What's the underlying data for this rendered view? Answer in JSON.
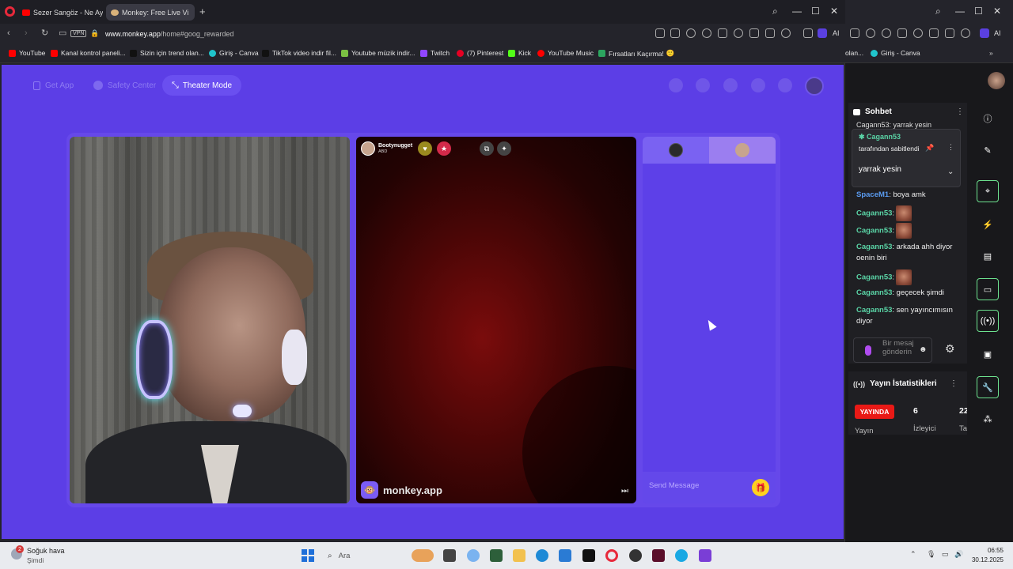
{
  "browser": {
    "tabs": [
      {
        "title": "Sezer Sangöz - Ne Ay Ge",
        "icon": "youtube-icon"
      },
      {
        "title": "Monkey: Free Live Vi",
        "icon": "monkey-icon"
      }
    ],
    "new_tab": "+",
    "vpn_label": "VPN",
    "url_host": "www.monkey.app",
    "url_path": "/home#goog_rewarded",
    "ai_label": "AI",
    "bookmarks": [
      {
        "label": "YouTube",
        "color": "#ff0000"
      },
      {
        "label": "Kanal kontrol paneli...",
        "color": "#ff0000"
      },
      {
        "label": "Sizin için trend olan...",
        "color": "#111111"
      },
      {
        "label": "Giriş - Canva",
        "color": "#20c4cb"
      },
      {
        "label": "TikTok video indir fil...",
        "color": "#111111"
      },
      {
        "label": "Youtube müzik indir...",
        "color": "#7bc043"
      },
      {
        "label": "Twitch",
        "color": "#9146ff"
      },
      {
        "label": "(7) Pinterest",
        "color": "#e60023"
      },
      {
        "label": "Kick",
        "color": "#53fc18"
      },
      {
        "label": "YouTube Music",
        "color": "#ff0000"
      },
      {
        "label": "Fırsatları Kaçırma!",
        "color": "#2ca55f"
      }
    ]
  },
  "monkey": {
    "get_app": "Get App",
    "safety_center": "Safety Center",
    "theater_mode": "Theater Mode",
    "partner_name": "Bootynugget",
    "partner_country": "ABD",
    "brand": "monkey.app",
    "send_placeholder": "Send Message",
    "accent": "#5c3ee6"
  },
  "right_window": {
    "bookmarks": [
      {
        "label": "olan...",
        "color": "#111111"
      },
      {
        "label": "Giriş - Canva",
        "color": "#20c4cb"
      }
    ],
    "ai_label": "AI",
    "chat_title": "Sohbet",
    "chat_cut": "Cagann53: yarrak yesin",
    "pinned": {
      "user": "Cagann53",
      "by": "tarafından sabitlendi",
      "message": "yarrak yesin"
    },
    "messages": [
      {
        "user": "SpaceM1",
        "color": "#5a9bf0",
        "text": ": boya amk"
      },
      {
        "user": "Cagann53",
        "color": "#5ad4a6",
        "text": ":",
        "emote": true
      },
      {
        "user": "Cagann53",
        "color": "#5ad4a6",
        "text": ":",
        "emote": true
      },
      {
        "user": "Cagann53",
        "color": "#5ad4a6",
        "text": ": arkada ahh diyor oenin biri"
      },
      {
        "user": "Cagann53",
        "color": "#5ad4a6",
        "text": ":",
        "emote": true
      },
      {
        "user": "Cagann53",
        "color": "#5ad4a6",
        "text": ": geçecek şimdi"
      },
      {
        "user": "Cagann53",
        "color": "#5ad4a6",
        "text": ": sen yayıncımısın diyor"
      }
    ],
    "chat_placeholder": "Bir mesaj gönderin",
    "stats_title": "Yayın İstatistikleri",
    "live_badge": "YAYINDA",
    "viewers_value": "6",
    "viewers_label": "İzleyici",
    "stat3_value": "22",
    "stat3_label": "Ta",
    "stat1_label": "Yayın"
  },
  "taskbar": {
    "weather_line1": "Soğuk hava",
    "weather_line2": "Şimdi",
    "weather_badge": "2",
    "search_label": "Ara",
    "time": "06:55",
    "date": "30.12.2025"
  }
}
